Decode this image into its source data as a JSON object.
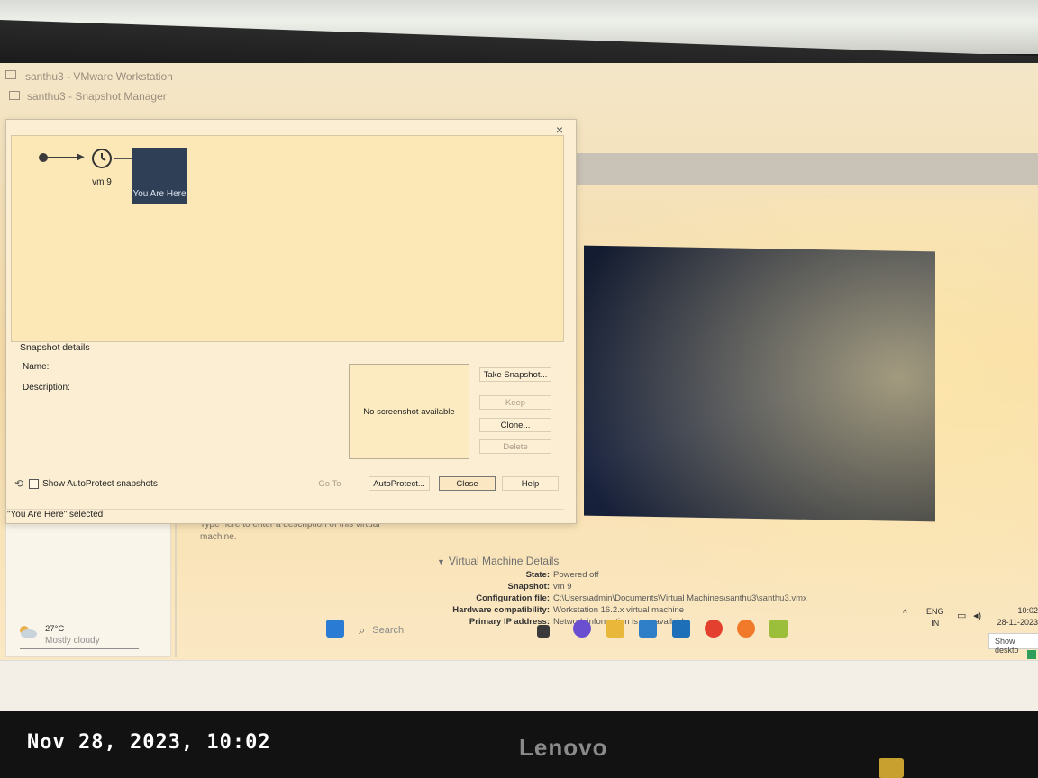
{
  "window": {
    "main_title": "santhu3 - VMware Workstation",
    "dialog_title": "santhu3 - Snapshot Manager",
    "close_glyph": "×"
  },
  "snapshot_tree": {
    "snapshot_label": "vm 9",
    "current_label": "You Are Here"
  },
  "snapshot_details": {
    "title": "Snapshot details",
    "name_label": "Name:",
    "description_label": "Description:",
    "screenshot_placeholder": "No screenshot available"
  },
  "buttons": {
    "take_snapshot": "Take Snapshot...",
    "keep": "Keep",
    "clone": "Clone...",
    "delete": "Delete",
    "go_to": "Go To",
    "autoprotect": "AutoProtect...",
    "close": "Close",
    "help": "Help"
  },
  "autoprotect_checkbox": {
    "label": "Show AutoProtect snapshots",
    "checked": false
  },
  "status_bar": "\"You Are Here\" selected",
  "vm_description": "Type here to enter a description of this virtual machine.",
  "vm_details": {
    "title": "Virtual Machine Details",
    "rows": [
      {
        "key": "State:",
        "value": "Powered off"
      },
      {
        "key": "Snapshot:",
        "value": "vm 9"
      },
      {
        "key": "Configuration file:",
        "value": "C:\\Users\\admin\\Documents\\Virtual Machines\\santhu3\\santhu3.vmx"
      },
      {
        "key": "Hardware compatibility:",
        "value": "Workstation 16.2.x virtual machine"
      },
      {
        "key": "Primary IP address:",
        "value": "Network information is not available"
      }
    ]
  },
  "show_desktop_tooltip": "Show deskto",
  "taskbar": {
    "weather_temp": "27°C",
    "weather_desc": "Mostly cloudy",
    "search_placeholder": "Search",
    "lang_line1": "ENG",
    "lang_line2": "IN",
    "time": "10:02",
    "date": "28-11-2023"
  },
  "monitor_brand": "Lenovo",
  "photo_timestamp": "Nov 28, 2023, 10:02",
  "colors": {
    "current_node": "#2f3f56",
    "vm_preview": "#1a2440",
    "dialog_bg": "#fbeed2"
  }
}
